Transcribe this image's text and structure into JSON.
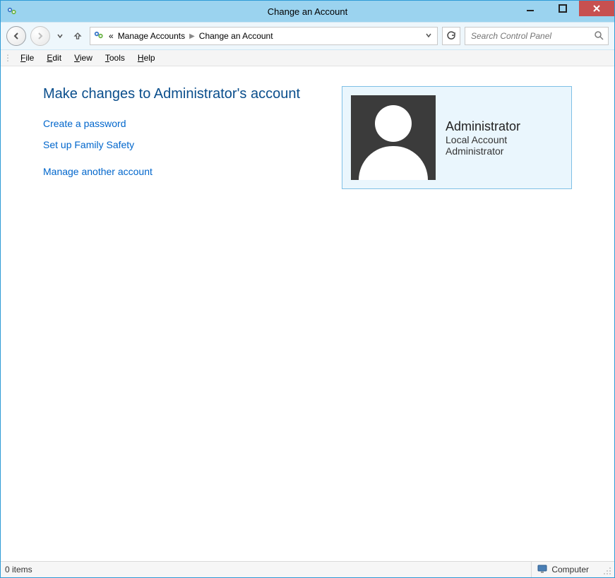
{
  "window": {
    "title": "Change an Account"
  },
  "nav": {
    "back_enabled": true,
    "forward_enabled": false,
    "breadcrumbs": {
      "prefix": "«",
      "parent": "Manage Accounts",
      "current": "Change an Account"
    }
  },
  "search": {
    "placeholder": "Search Control Panel"
  },
  "menu": {
    "file": "File",
    "edit": "Edit",
    "view": "View",
    "tools": "Tools",
    "help": "Help"
  },
  "main": {
    "heading": "Make changes to Administrator's account",
    "links": {
      "create_password": "Create a password",
      "family_safety": "Set up Family Safety",
      "manage_another": "Manage another account"
    },
    "account": {
      "name": "Administrator",
      "type": "Local Account",
      "role": "Administrator"
    }
  },
  "status": {
    "items": "0 items",
    "location": "Computer"
  }
}
